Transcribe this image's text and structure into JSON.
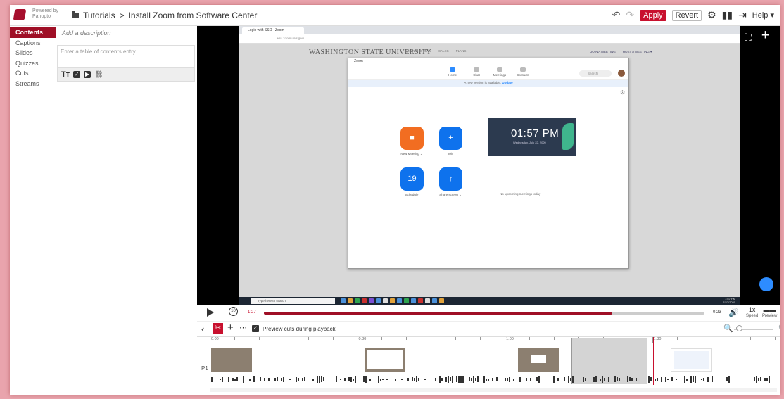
{
  "brand": {
    "powered_by": "Powered by Panopto"
  },
  "breadcrumb": {
    "folder": "Tutorials",
    "separator": ">",
    "session": "Install Zoom from Software Center"
  },
  "toolbar": {
    "apply": "Apply",
    "revert": "Revert",
    "help": "Help ▾"
  },
  "leftnav": {
    "items": [
      {
        "label": "Contents",
        "active": true
      },
      {
        "label": "Captions"
      },
      {
        "label": "Slides"
      },
      {
        "label": "Quizzes"
      },
      {
        "label": "Cuts"
      },
      {
        "label": "Streams"
      }
    ]
  },
  "contents": {
    "description_placeholder": "Add a description",
    "toc_placeholder": "Enter a table of contents entry",
    "toolbar_tt": "Tт"
  },
  "video": {
    "browser_tab": "Login with SSO - Zoom",
    "url": "wsu.zoom.us/signin",
    "site_title": "WASHINGTON STATE UNIVERSITY",
    "site_links": [
      "JOIN THE TEAM",
      "SALES",
      "PLANS"
    ],
    "site_right": [
      "JOIN A MEETING",
      "HOST A MEETING ▾"
    ],
    "zoom_title": "Zoom",
    "zoom_nav": [
      "Home",
      "Chat",
      "Meetings",
      "Contacts"
    ],
    "zoom_search": "Search",
    "zoom_banner": "A new version is available.",
    "zoom_banner_link": "Update",
    "clock_time": "01:57 PM",
    "clock_date": "Wednesday, July 22, 2020",
    "zoom_buttons": [
      "New Meeting ⌄",
      "Join",
      "Schedule",
      "Share screen ⌄"
    ],
    "no_meetings": "No upcoming meetings today",
    "taskbar_search": "Type here to search",
    "taskbar_clock": [
      "1:57 PM",
      "7/22/2020"
    ]
  },
  "playback": {
    "current": "1:27",
    "remaining": "-0:23",
    "speed": "1x",
    "speed_label": "Speed",
    "preview_label": "Preview",
    "progress": 0.79
  },
  "cutbar": {
    "preview_cuts": "Preview cuts during playback",
    "preview_cuts_checked": true
  },
  "timeline": {
    "track_label": "P1",
    "ruler": [
      "0:00",
      "0:30",
      "1:00",
      "1:30"
    ],
    "cut_start": "1:14",
    "cut_end": "1:29",
    "playhead": "1:31"
  },
  "colors": {
    "accent": "#9f0f26",
    "apply": "#c8102e",
    "zoom_blue": "#0e72ed",
    "zoom_orange": "#f26d21"
  }
}
